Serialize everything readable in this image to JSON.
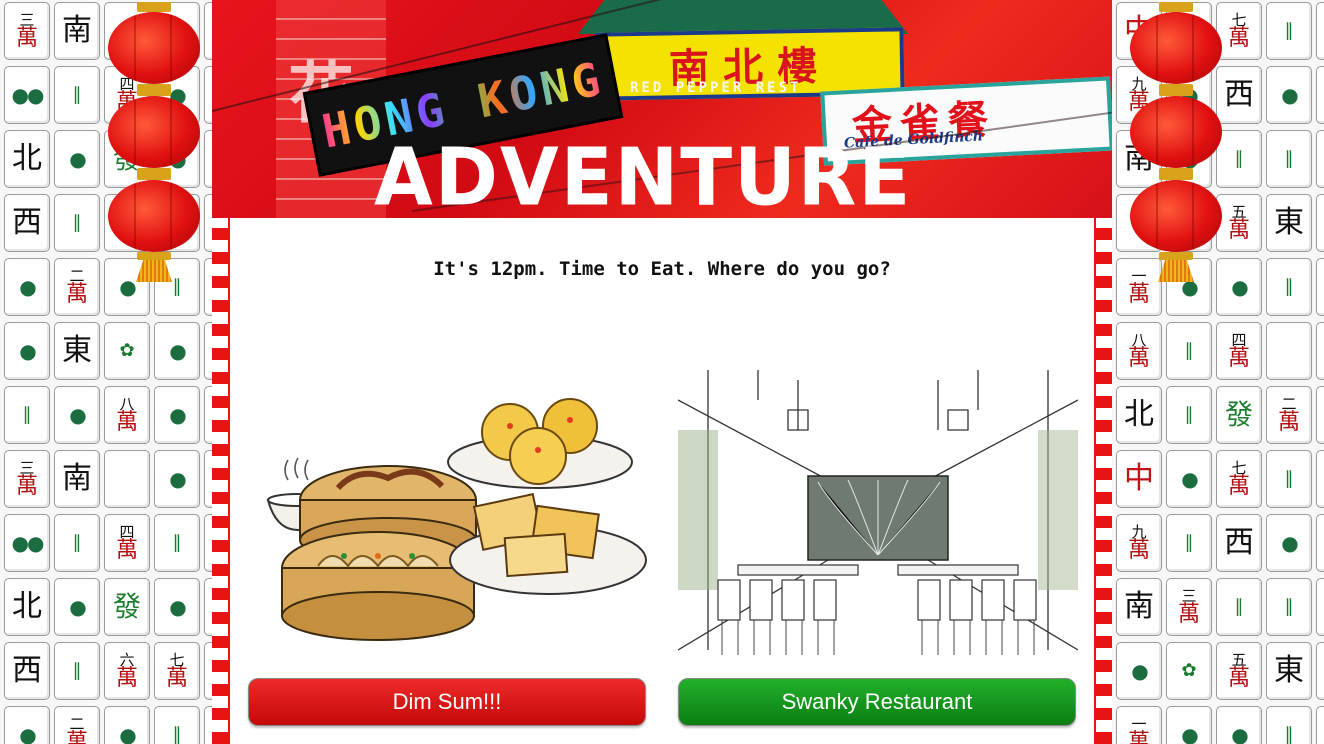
{
  "header": {
    "logo_line1": "HONG KONG",
    "logo_line2": "ADVENTURE",
    "sign_nanbei": "南北樓",
    "sign_nanbei_sub": "RED PEPPER REST",
    "sign_goldfinch": "金雀餐",
    "sign_goldfinch_sub": "Cafe de Goldfinch",
    "tower_char": "花"
  },
  "prompt": {
    "question": "It's 12pm. Time to Eat. Where do you go?"
  },
  "choices": [
    {
      "label": "Dim Sum!!!",
      "image": "dim-sum-illustration",
      "color": "#d81010"
    },
    {
      "label": "Swanky Restaurant",
      "image": "restaurant-sketch",
      "color": "#119a18"
    }
  ],
  "tiles_left": [
    [
      "三",
      "萬"
    ],
    [
      "",
      "南"
    ],
    [
      "",
      "●"
    ],
    [
      "",
      "●"
    ],
    [
      "",
      "●"
    ],
    [
      "",
      "●●"
    ],
    [
      "",
      "‖"
    ],
    [
      "四",
      "萬"
    ],
    [
      "",
      "●"
    ],
    [
      "",
      "●"
    ],
    [
      "",
      "北"
    ],
    [
      "",
      "●"
    ],
    [
      "",
      "發"
    ],
    [
      "",
      "●"
    ],
    [
      "",
      "●"
    ],
    [
      "",
      "西"
    ],
    [
      "",
      "‖"
    ],
    [
      "",
      "●"
    ],
    [
      "",
      "●"
    ],
    [
      "",
      "●"
    ],
    [
      "",
      "●"
    ],
    [
      "二",
      "萬"
    ],
    [
      "",
      "●"
    ],
    [
      "",
      "‖"
    ],
    [
      "",
      "●"
    ],
    [
      "",
      "●"
    ],
    [
      "",
      "東"
    ],
    [
      "",
      "✿"
    ],
    [
      "",
      "●"
    ],
    [
      "",
      "●"
    ],
    [
      "",
      "‖"
    ],
    [
      "",
      "●"
    ],
    [
      "八",
      "萬"
    ],
    [
      "",
      "●"
    ],
    [
      "",
      "●"
    ],
    [
      "三",
      "萬"
    ],
    [
      "",
      "南"
    ],
    [
      "",
      ""
    ],
    [
      "",
      "●"
    ],
    [
      "",
      "●"
    ],
    [
      "",
      "●●"
    ],
    [
      "",
      "‖"
    ],
    [
      "四",
      "萬"
    ],
    [
      "",
      "‖"
    ],
    [
      "",
      "●"
    ],
    [
      "",
      "北"
    ],
    [
      "",
      "●"
    ],
    [
      "",
      "發"
    ],
    [
      "",
      "●"
    ],
    [
      "",
      "●"
    ],
    [
      "",
      "西"
    ],
    [
      "",
      "‖"
    ],
    [
      "六",
      "萬"
    ],
    [
      "七",
      "萬"
    ],
    [
      "",
      "●"
    ],
    [
      "",
      "●"
    ],
    [
      "二",
      "萬"
    ],
    [
      "",
      "●"
    ],
    [
      "",
      "‖"
    ],
    [
      "",
      "●"
    ]
  ],
  "tiles_right": [
    [
      "",
      "中"
    ],
    [
      "",
      "●"
    ],
    [
      "七",
      "萬"
    ],
    [
      "",
      "‖"
    ],
    [
      "",
      "●"
    ],
    [
      "九",
      "萬"
    ],
    [
      "",
      "●"
    ],
    [
      "",
      "西"
    ],
    [
      "",
      "●"
    ],
    [
      "",
      "●"
    ],
    [
      "",
      "南"
    ],
    [
      "",
      "●"
    ],
    [
      "",
      "‖"
    ],
    [
      "",
      "‖"
    ],
    [
      "",
      "●"
    ],
    [
      "",
      "●"
    ],
    [
      "",
      "●"
    ],
    [
      "五",
      "萬"
    ],
    [
      "",
      "東"
    ],
    [
      "",
      "●"
    ],
    [
      "一",
      "萬"
    ],
    [
      "",
      "●"
    ],
    [
      "",
      "●"
    ],
    [
      "",
      "‖"
    ],
    [
      "",
      "●"
    ],
    [
      "八",
      "萬"
    ],
    [
      "",
      "‖"
    ],
    [
      "四",
      "萬"
    ],
    [
      "",
      ""
    ],
    [
      "",
      "●"
    ],
    [
      "",
      "北"
    ],
    [
      "",
      "‖"
    ],
    [
      "",
      "發"
    ],
    [
      "二",
      "萬"
    ],
    [
      "",
      "●"
    ],
    [
      "",
      "中"
    ],
    [
      "",
      "●"
    ],
    [
      "七",
      "萬"
    ],
    [
      "",
      "‖"
    ],
    [
      "",
      "●"
    ],
    [
      "九",
      "萬"
    ],
    [
      "",
      "‖"
    ],
    [
      "",
      "西"
    ],
    [
      "",
      "●"
    ],
    [
      "",
      "●"
    ],
    [
      "",
      "南"
    ],
    [
      "三",
      "萬"
    ],
    [
      "",
      "‖"
    ],
    [
      "",
      "‖"
    ],
    [
      "",
      "●"
    ],
    [
      "",
      "●"
    ],
    [
      "",
      "✿"
    ],
    [
      "五",
      "萬"
    ],
    [
      "",
      "東"
    ],
    [
      "",
      "●"
    ],
    [
      "一",
      "萬"
    ],
    [
      "",
      "●"
    ],
    [
      "",
      "●"
    ],
    [
      "",
      "‖"
    ],
    [
      "",
      "●"
    ]
  ]
}
